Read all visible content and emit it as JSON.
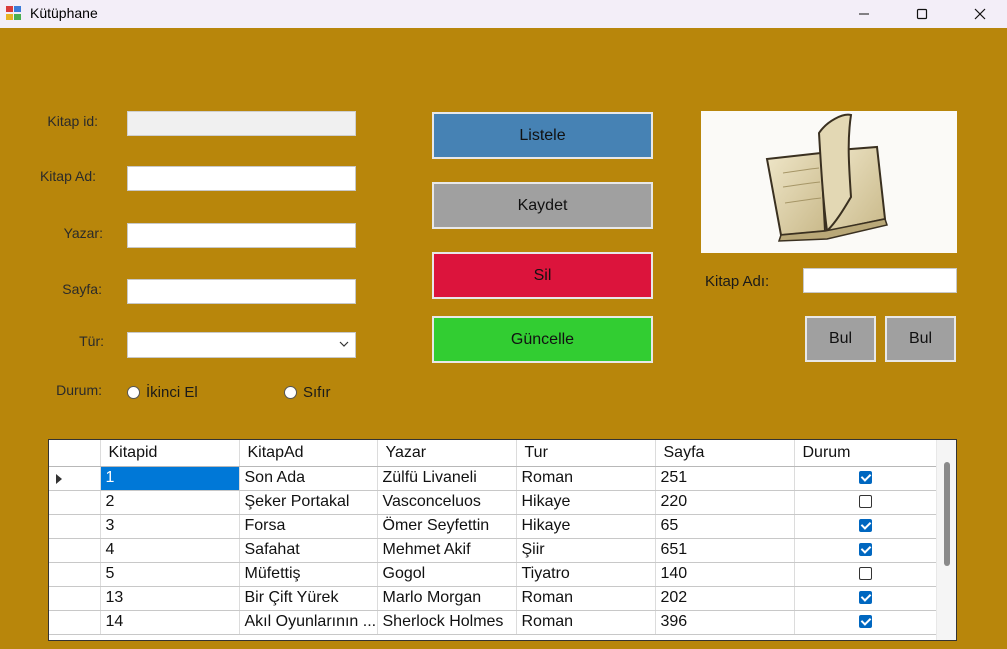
{
  "window": {
    "title": "Kütüphane"
  },
  "form": {
    "labels": {
      "id": "Kitap id:",
      "name": "Kitap Ad:",
      "author": "Yazar:",
      "pages": "Sayfa:",
      "genre": "Tür:",
      "status": "Durum:"
    },
    "fields": {
      "id": "",
      "name": "",
      "author": "",
      "pages": "",
      "genre": ""
    },
    "radios": {
      "second_hand": "İkinci El",
      "new": "Sıfır"
    }
  },
  "buttons": {
    "list": "Listele",
    "save": "Kaydet",
    "delete": "Sil",
    "update": "Güncelle",
    "find1": "Bul",
    "find2": "Bul"
  },
  "search": {
    "label": "Kitap Adı:",
    "value": ""
  },
  "colors": {
    "background": "#b8860b",
    "list_button": "#4682b4",
    "save_button": "#a0a0a0",
    "delete_button": "#dc143c",
    "update_button": "#32cd32"
  },
  "grid": {
    "columns": [
      "Kitapid",
      "KitapAd",
      "Yazar",
      "Tur",
      "Sayfa",
      "Durum"
    ],
    "rows": [
      {
        "id": "1",
        "name": "Son Ada",
        "author": "Zülfü Livaneli",
        "genre": "Roman",
        "pages": "251",
        "status": true
      },
      {
        "id": "2",
        "name": "Şeker Portakal",
        "author": "Vasconceluos",
        "genre": "Hikaye",
        "pages": "220",
        "status": false
      },
      {
        "id": "3",
        "name": "Forsa",
        "author": "Ömer Seyfettin",
        "genre": "Hikaye",
        "pages": "65",
        "status": true
      },
      {
        "id": "4",
        "name": "Safahat",
        "author": "Mehmet Akif",
        "genre": "Şiir",
        "pages": "651",
        "status": true
      },
      {
        "id": "5",
        "name": "Müfettiş",
        "author": "Gogol",
        "genre": "Tiyatro",
        "pages": "140",
        "status": false
      },
      {
        "id": "13",
        "name": "Bir Çift Yürek",
        "author": "Marlo Morgan",
        "genre": "Roman",
        "pages": "202",
        "status": true
      },
      {
        "id": "14",
        "name": "Akıl Oyunlarının ...",
        "author": "Sherlock Holmes",
        "genre": "Roman",
        "pages": "396",
        "status": true
      }
    ]
  }
}
